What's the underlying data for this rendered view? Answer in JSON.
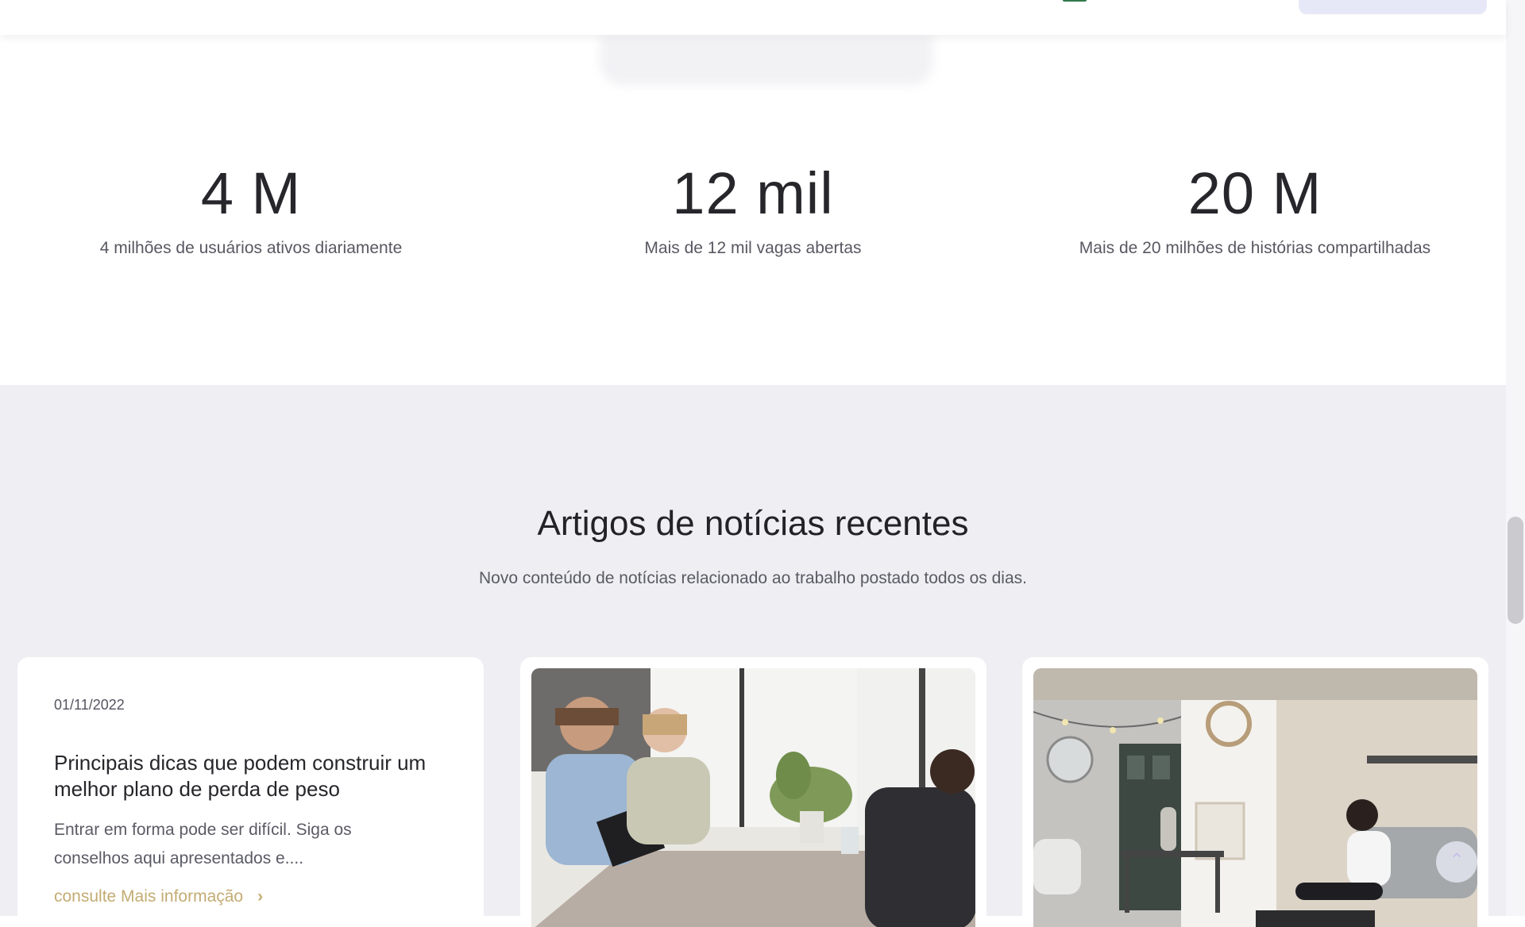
{
  "stats": [
    {
      "value": "4 M",
      "label": "4 milhões de usuários ativos diariamente"
    },
    {
      "value": "12 mil",
      "label": "Mais de 12 mil vagas abertas"
    },
    {
      "value": "20 M",
      "label": "Mais de 20 milhões de histórias compartilhadas"
    }
  ],
  "news": {
    "title": "Artigos de notícias recentes",
    "subtitle": "Novo conteúdo de notícias relacionado ao trabalho postado todos os dias.",
    "cards": [
      {
        "date": "01/11/2022",
        "title": "Principais dicas que podem construir um melhor plano de perda de peso",
        "excerpt": "Entrar em forma pode ser difícil. Siga os conselhos aqui apresentados e....",
        "more_label": "consulte Mais informação"
      }
    ]
  },
  "colors": {
    "accent": "#c3ac73",
    "section_bg": "#eeeef3"
  },
  "icons": {
    "more_chevron": "chevron-right-icon",
    "back_to_top": "arrow-up-icon"
  }
}
